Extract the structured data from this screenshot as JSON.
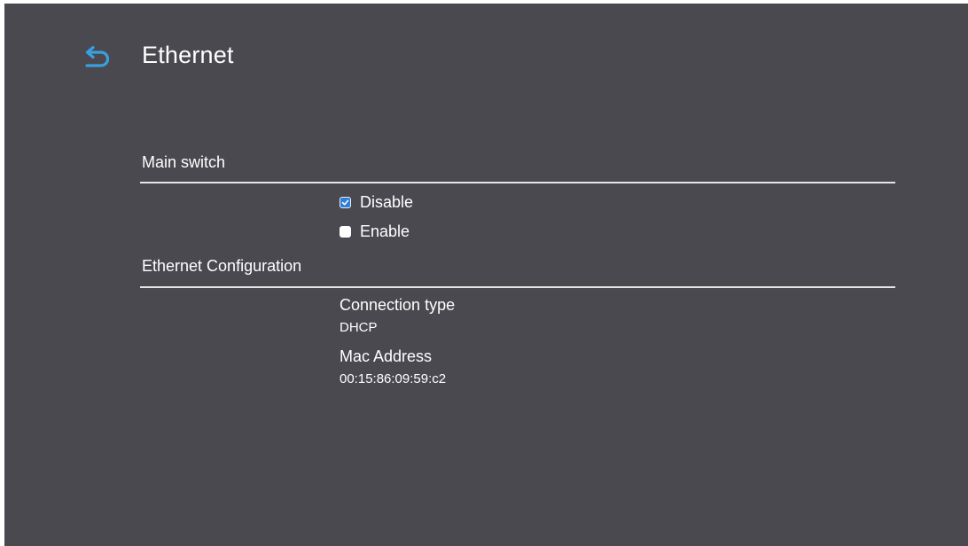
{
  "header": {
    "back_icon": "back-arrow-icon",
    "title": "Ethernet"
  },
  "main_switch": {
    "label": "Main switch",
    "options": [
      {
        "label": "Disable",
        "checked": true
      },
      {
        "label": "Enable",
        "checked": false
      }
    ]
  },
  "ethernet_configuration": {
    "label": "Ethernet Configuration",
    "connection_type": {
      "label": "Connection type",
      "value": "DHCP"
    },
    "mac_address": {
      "label": "Mac Address",
      "value": "00:15:86:09:59:c2"
    }
  },
  "colors": {
    "background": "#4a4950",
    "accent": "#2f7fd9",
    "back_icon": "#3a9fe0",
    "text": "#ffffff"
  }
}
